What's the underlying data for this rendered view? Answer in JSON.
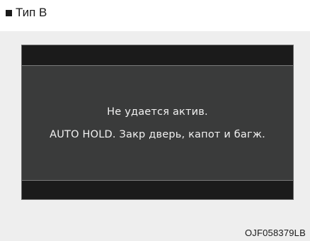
{
  "header": {
    "label": "Тип B"
  },
  "display": {
    "message_line_1": "Не удается актив.",
    "message_line_2": "AUTO HOLD. Закр дверь, капот и багж."
  },
  "figure": {
    "code": "OJF058379LB"
  },
  "colors": {
    "page_background": "#ffffff",
    "content_background": "#eeeeee",
    "display_main": "#3a3b3b",
    "display_bands": "#1b1b1b",
    "display_text": "#f2f2f2"
  }
}
